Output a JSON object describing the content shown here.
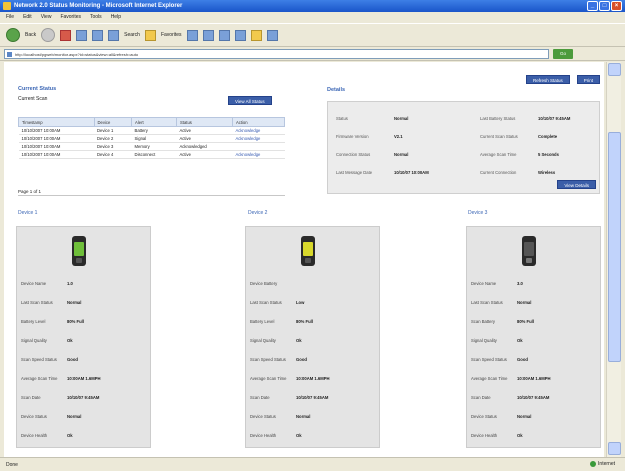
{
  "window": {
    "title": "Network 2.0 Status Monitoring - Microsoft Internet Explorer",
    "menu": [
      "File",
      "Edit",
      "View",
      "Favorites",
      "Tools",
      "Help"
    ],
    "toolbar": {
      "back_label": "Back",
      "search_label": "Search",
      "favorites_label": "Favorites"
    },
    "address": {
      "value": "http://localhost/pgweb/monitor.aspx?id=status&view=all&refresh=auto",
      "go_label": "Go"
    },
    "status": {
      "left": "Done",
      "zone": "Internet"
    }
  },
  "page": {
    "top_buttons": {
      "refresh_label": "Refresh Status",
      "print_label": "Print"
    },
    "current_status": {
      "title": "Current Status",
      "sub_label": "Current Scan",
      "view_button": "View All Status",
      "columns": [
        "Timestamp",
        "Device",
        "Alert",
        "Status",
        "Action"
      ],
      "rows": [
        [
          "10/10/2007 10:00AM",
          "Device 1",
          "Battery",
          "Active",
          "Acknowledge"
        ],
        [
          "10/10/2007 10:00AM",
          "Device 2",
          "Signal",
          "Active",
          "Acknowledge"
        ],
        [
          "10/10/2007 10:00AM",
          "Device 3",
          "Memory",
          "Acknowledged",
          ""
        ],
        [
          "10/10/2007 10:00AM",
          "Device 4",
          "Disconnect",
          "Active",
          "Acknowledge"
        ]
      ],
      "pager": "Page 1 of 1"
    },
    "details": {
      "title": "Details",
      "left": [
        {
          "label": "Status",
          "value": "Normal"
        },
        {
          "label": "Firmware Version",
          "value": "V2.1"
        },
        {
          "label": "Connection Status",
          "value": "Normal"
        },
        {
          "label": "Last Message Date",
          "value": "10/10/07 10:00AM"
        }
      ],
      "right": [
        {
          "label": "Last Battery Status",
          "value": "10/10/07 9:45AM"
        },
        {
          "label": "Current Scan Status",
          "value": "Complete"
        },
        {
          "label": "Average Scan Time",
          "value": "5 Seconds"
        },
        {
          "label": "Current Connection",
          "value": "Wireless"
        }
      ],
      "button": "View Details"
    },
    "phones": [
      {
        "title": "Device 1",
        "color": "#6fbf3a",
        "fields": [
          {
            "label": "Device Name",
            "value": "1.0"
          },
          {
            "label": "Last Scan Status",
            "value": "Normal"
          },
          {
            "label": "Battery Level",
            "value": "80% Full"
          },
          {
            "label": "Signal Quality",
            "value": "Ok"
          },
          {
            "label": "Scan Speed Status",
            "value": "Good"
          },
          {
            "label": "Average Scan Time",
            "value": "10:00AM 1.6MPH"
          },
          {
            "label": "Scan Date",
            "value": "10/10/07 9:45AM"
          },
          {
            "label": "Device Status",
            "value": "Normal"
          },
          {
            "label": "Device Health",
            "value": "Ok"
          }
        ]
      },
      {
        "title": "Device 2",
        "color": "#d9d92c",
        "fields": [
          {
            "label": "Device Battery",
            "value": ""
          },
          {
            "label": "Last Scan Status",
            "value": "Low"
          },
          {
            "label": "Battery Level",
            "value": "80% Full"
          },
          {
            "label": "Signal Quality",
            "value": "Ok"
          },
          {
            "label": "Scan Speed Status",
            "value": "Good"
          },
          {
            "label": "Average Scan Time",
            "value": "10:00AM 1.6MPH"
          },
          {
            "label": "Scan Date",
            "value": "10/10/07 9:45AM"
          },
          {
            "label": "Device Status",
            "value": "Normal"
          },
          {
            "label": "Device Health",
            "value": "Ok"
          }
        ]
      },
      {
        "title": "Device 3",
        "color": "#555555",
        "fields": [
          {
            "label": "Device Name",
            "value": "3.0"
          },
          {
            "label": "Last Scan Status",
            "value": "Normal"
          },
          {
            "label": "Scan Battery",
            "value": "80% Full"
          },
          {
            "label": "Signal Quality",
            "value": "Ok"
          },
          {
            "label": "Scan Speed Status",
            "value": "Good"
          },
          {
            "label": "Average Scan Time",
            "value": "10:00AM 1.6MPH"
          },
          {
            "label": "Scan Date",
            "value": "10/10/07 9:45AM"
          },
          {
            "label": "Device Status",
            "value": "Normal"
          },
          {
            "label": "Device Health",
            "value": "Ok"
          }
        ]
      }
    ]
  }
}
